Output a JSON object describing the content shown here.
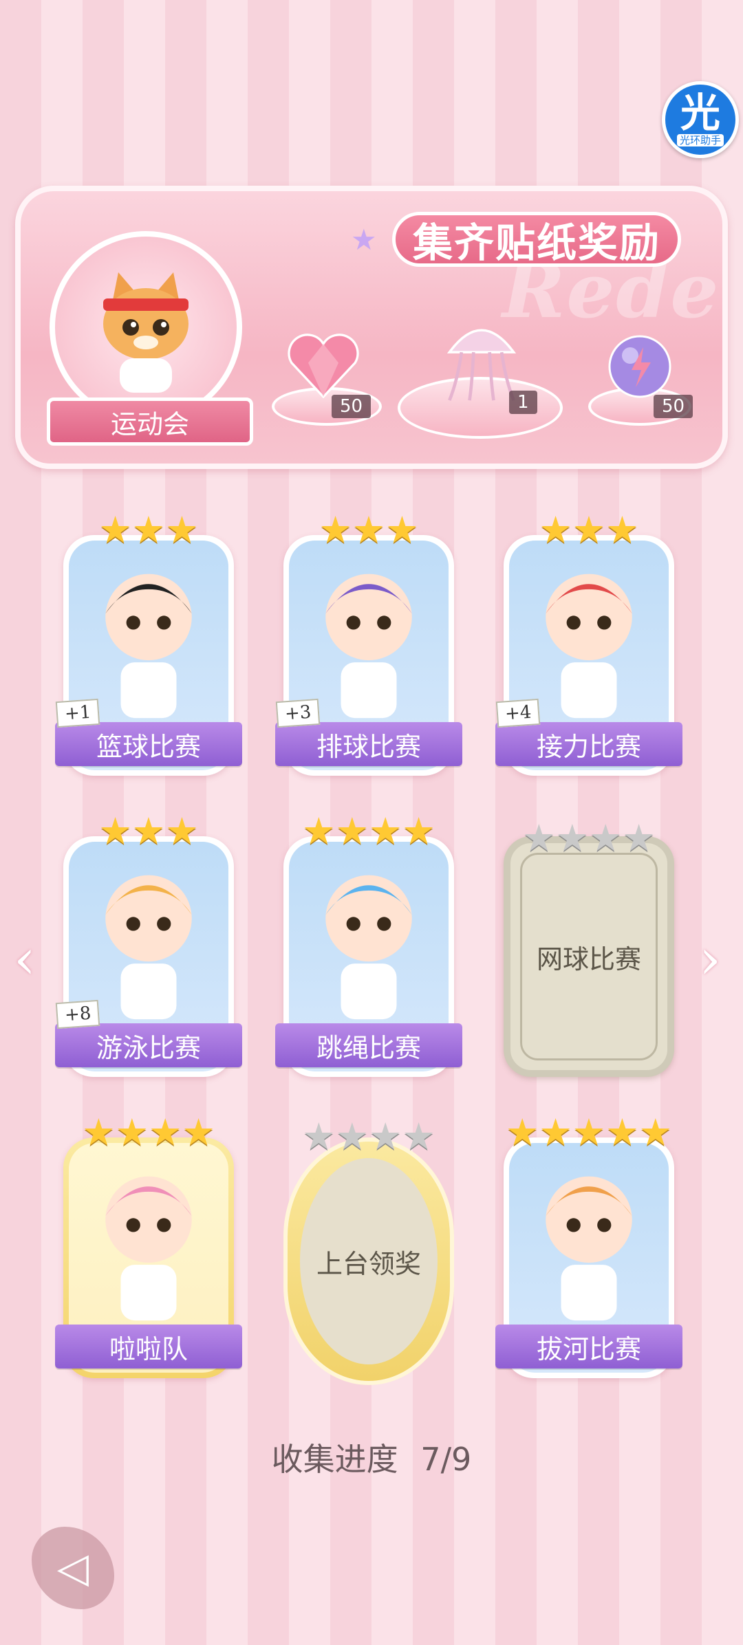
{
  "helper_badge": {
    "glyph": "光",
    "label": "光环助手"
  },
  "banner": {
    "title": "集齐贴纸奖励",
    "watermark": "Redeem",
    "event_label": "运动会",
    "rewards": [
      {
        "icon": "heart-gem-icon",
        "count": "50"
      },
      {
        "icon": "jellyfish-icon",
        "count": "1"
      },
      {
        "icon": "orb-icon",
        "count": "50"
      }
    ]
  },
  "cards": [
    {
      "name": "篮球比赛",
      "stars_on": 3,
      "stars_total": 3,
      "bonus": "+1",
      "locked": false
    },
    {
      "name": "排球比赛",
      "stars_on": 3,
      "stars_total": 3,
      "bonus": "+3",
      "locked": false
    },
    {
      "name": "接力比赛",
      "stars_on": 3,
      "stars_total": 3,
      "bonus": "+4",
      "locked": false
    },
    {
      "name": "游泳比赛",
      "stars_on": 3,
      "stars_total": 3,
      "bonus": "+8",
      "locked": false
    },
    {
      "name": "跳绳比赛",
      "stars_on": 4,
      "stars_total": 4,
      "bonus": "",
      "locked": false
    },
    {
      "name": "网球比赛",
      "stars_on": 0,
      "stars_total": 4,
      "bonus": "",
      "locked": true
    },
    {
      "name": "啦啦队",
      "stars_on": 4,
      "stars_total": 4,
      "bonus": "",
      "locked": false
    },
    {
      "name": "上台领奖",
      "stars_on": 0,
      "stars_total": 4,
      "bonus": "",
      "locked": true
    },
    {
      "name": "拔河比赛",
      "stars_on": 5,
      "stars_total": 5,
      "bonus": "",
      "locked": false
    }
  ],
  "progress": {
    "label": "收集进度",
    "value": "7/9"
  },
  "colors": {
    "accent_purple": "#8f5fd3",
    "accent_pink": "#e76a88",
    "star_gold": "#ffc933"
  }
}
